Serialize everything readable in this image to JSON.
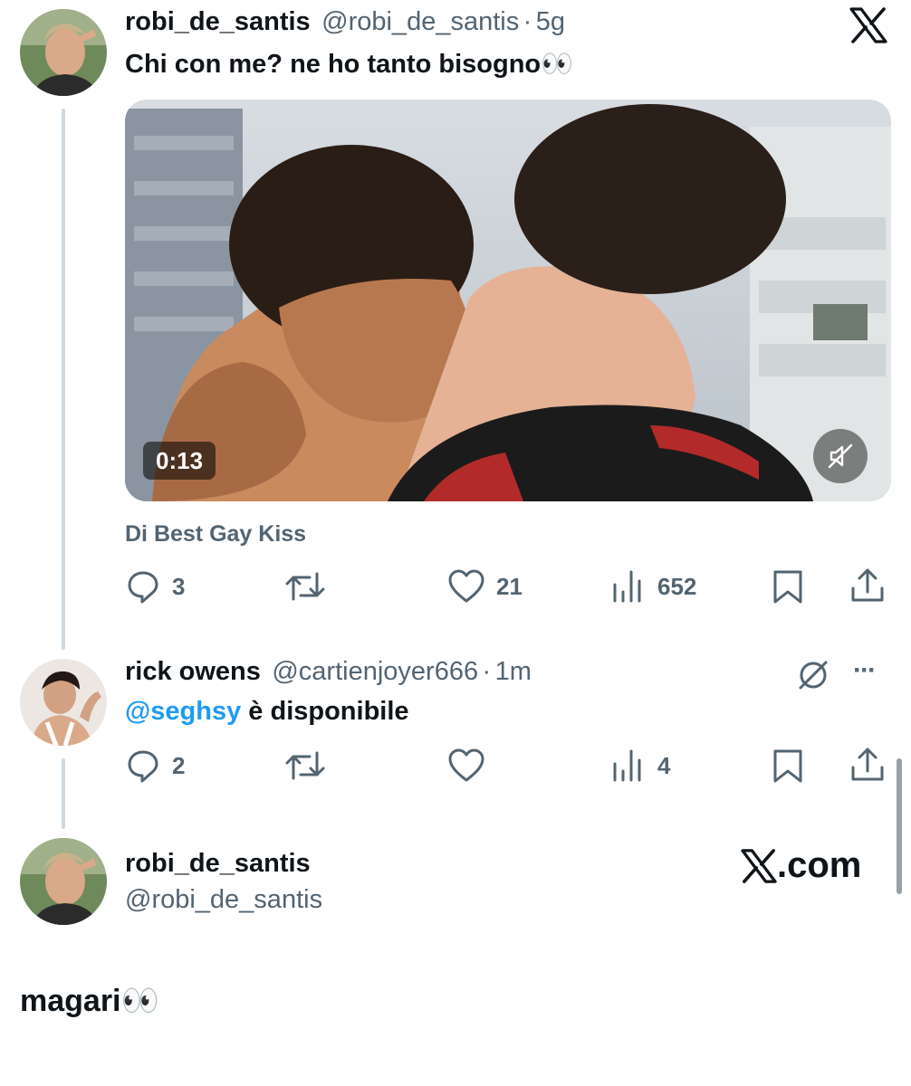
{
  "tweet1": {
    "name": "robi_de_santis",
    "handle": "@robi_de_santis",
    "separator": "·",
    "time": "5g",
    "text": "Chi con me? ne ho tanto bisogno👀",
    "video": {
      "duration": "0:13",
      "muted": true
    },
    "source": "Di Best Gay Kiss",
    "actions": {
      "replies": "3",
      "likes": "21",
      "views": "652"
    }
  },
  "tweet2": {
    "name": "rick owens",
    "handle": "@cartienjoyer666",
    "separator": "·",
    "time": "1m",
    "mention": "@seghsy",
    "text_rest": " è disponibile",
    "more": "···",
    "actions": {
      "replies": "2",
      "views": "4"
    }
  },
  "profile": {
    "name": "robi_de_santis",
    "handle": "@robi_de_santis",
    "brand": "X.com"
  },
  "reply_text": "magari👀",
  "icons": [
    "x-logo",
    "reply-icon",
    "retweet-icon",
    "like-icon",
    "views-icon",
    "bookmark-icon",
    "share-icon",
    "mute-icon",
    "grok-icon",
    "more-icon"
  ],
  "colors": {
    "text": "#0f1419",
    "secondary": "#536471",
    "link": "#1d9bf0",
    "line": "#cfd9de"
  }
}
